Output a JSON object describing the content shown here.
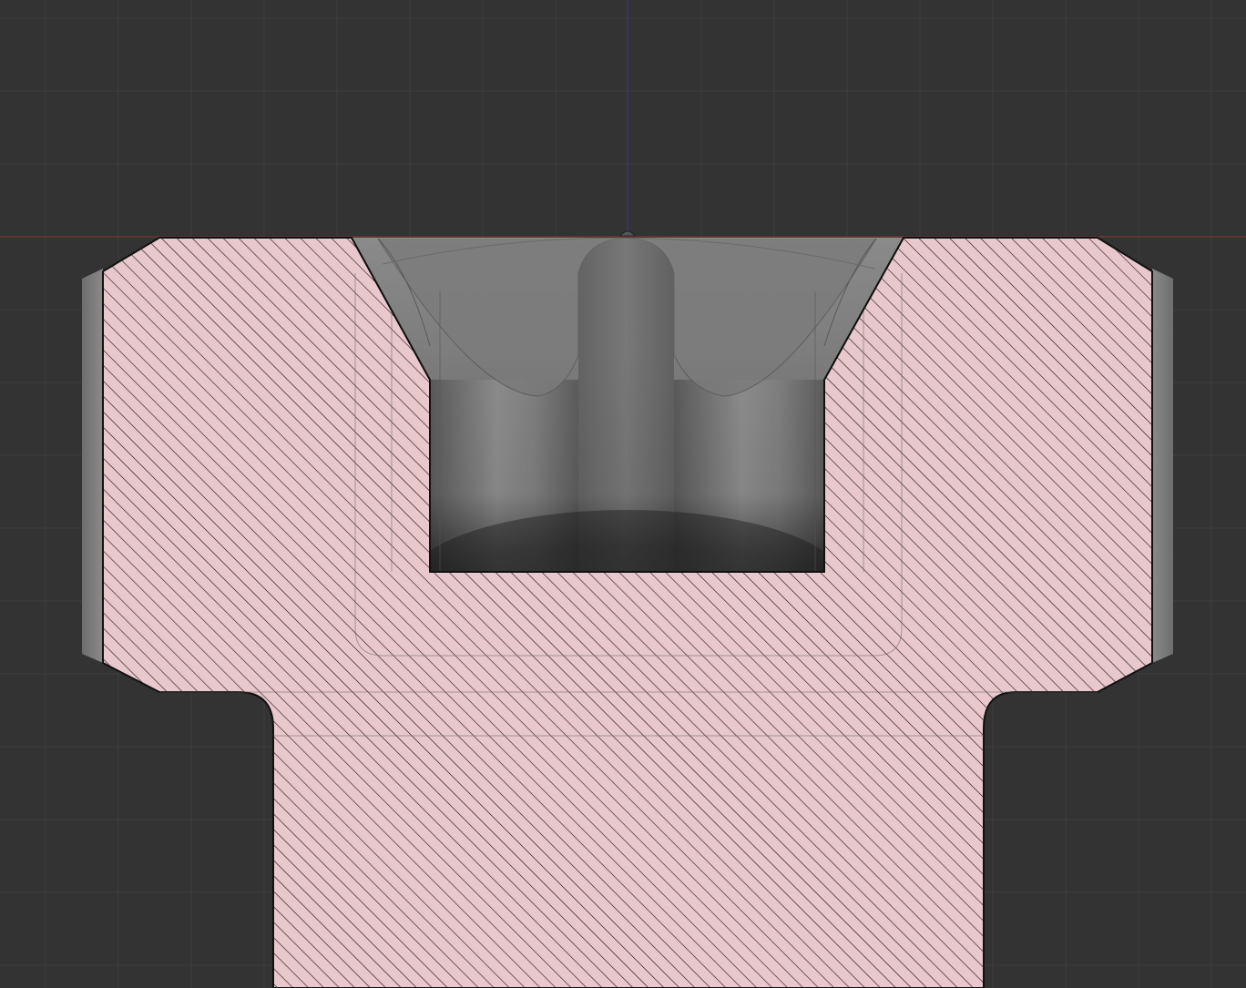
{
  "app": {
    "view": "cad-3d-viewport",
    "mode": "section-view"
  },
  "colors": {
    "background": "#333333",
    "grid_line": "#3e3e3e",
    "axis_x": "#8a3a3a",
    "axis_z": "#3a3a8a",
    "section_fill": "#e8c8cc",
    "hatch_line": "#2a1a1d",
    "outline": "#111111",
    "rim_side": "#7b7b7b",
    "socket_light": "#8e8e8e",
    "socket_dark": "#1e1e1e"
  },
  "objects": [
    {
      "name": "socket-head-cap-screw",
      "kind": "section-cut",
      "hatched": true
    },
    {
      "name": "torx-socket-recess",
      "kind": "shaded-geometry"
    }
  ]
}
